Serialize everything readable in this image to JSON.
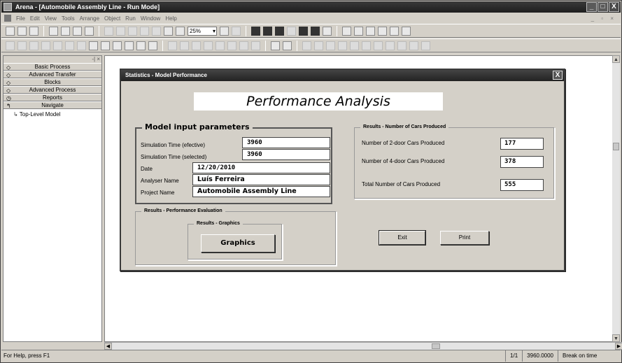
{
  "window": {
    "title": "Arena - [Automobile Assembly Line - Run Mode]",
    "controls": {
      "minimize": "_",
      "restore": "□",
      "close": "X"
    }
  },
  "menu": [
    "File",
    "Edit",
    "View",
    "Tools",
    "Arrange",
    "Object",
    "Run",
    "Window",
    "Help"
  ],
  "toolbar": {
    "zoom": "25%"
  },
  "project_bar": {
    "panels": [
      "Basic Process",
      "Advanced Transfer",
      "Blocks",
      "Advanced Process",
      "Reports",
      "Navigate"
    ],
    "tree_item": "Top-Level Model"
  },
  "dialog": {
    "title": "Statistics - Model Performance",
    "close": "X",
    "heading": "Performance Analysis",
    "inputs": {
      "legend": "Model input parameters",
      "rows": [
        {
          "label": "Simulation Time (efective)",
          "value": "3960"
        },
        {
          "label": "Simulation Time (selected)",
          "value": "3960"
        },
        {
          "label": "Date",
          "value": "12/20/2010"
        },
        {
          "label": "Analyser Name",
          "value": "Luís Ferreira"
        },
        {
          "label": "Project Name",
          "value": "Automobile Assembly Line"
        }
      ]
    },
    "cars": {
      "legend": "Results - Number of Cars Produced",
      "rows": [
        {
          "label": "Number of 2-door Cars Produced",
          "value": "177"
        },
        {
          "label": "Number of 4-door Cars Produced",
          "value": "378"
        },
        {
          "label": "Total Number of Cars Produced",
          "value": "555"
        }
      ]
    },
    "evaluation": {
      "legend": "Results - Performance Evaluation",
      "graphics_legend": "Results - Graphics",
      "graphics_button": "Graphics"
    },
    "buttons": {
      "exit": "Exit",
      "print": "Print"
    }
  },
  "status": {
    "help": "For Help, press F1",
    "replication": "1/1",
    "time": "3960.0000",
    "mode": "Break on time"
  }
}
